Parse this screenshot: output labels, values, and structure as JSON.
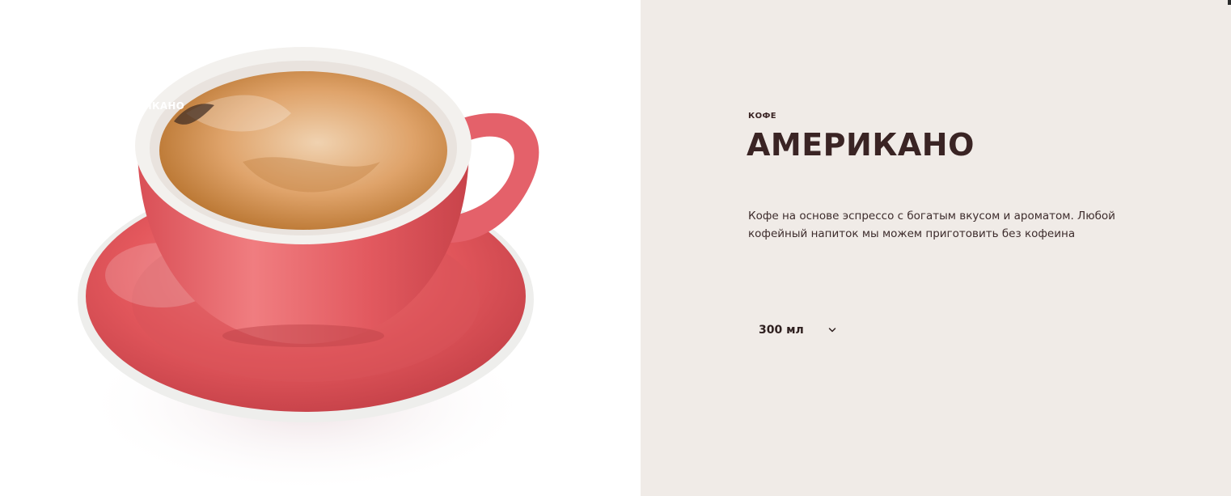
{
  "product": {
    "image_overlay_label": "АМЕРИКАНО",
    "category": "КОФЕ",
    "title": "АМЕРИКАНО",
    "description": "Кофе на основе эспрессо с богатым вкусом и ароматом. Любой кофейный напиток мы можем приготовить без кофеина",
    "size_selected": "300 мл",
    "size_icon": "chevron-down-icon"
  },
  "colors": {
    "info_background": "#f0ebe7",
    "text_dark": "#3a2424",
    "cup_red": "#e05a5f"
  }
}
